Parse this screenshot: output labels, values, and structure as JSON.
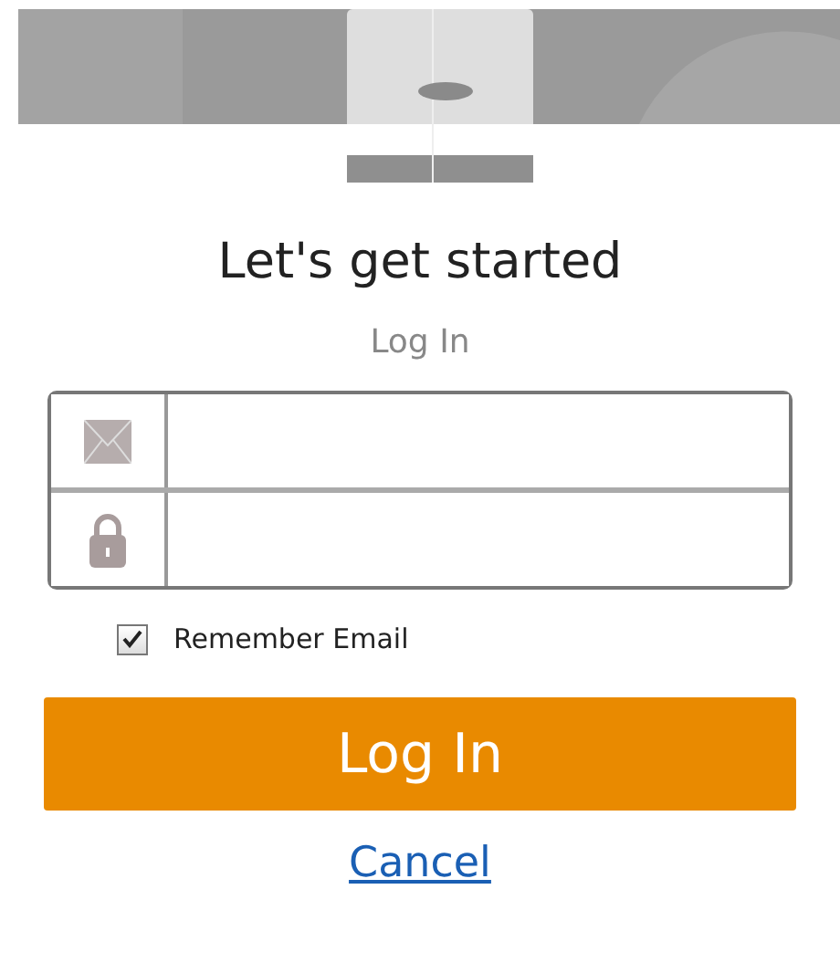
{
  "title": "Let's get started",
  "subtitle": "Log In",
  "fields": [
    {
      "kind": "email"
    },
    {
      "kind": "password"
    }
  ],
  "remember": {
    "label": "Remember Email",
    "checked": true
  },
  "submit": "Log In",
  "cancel": "Cancel"
}
